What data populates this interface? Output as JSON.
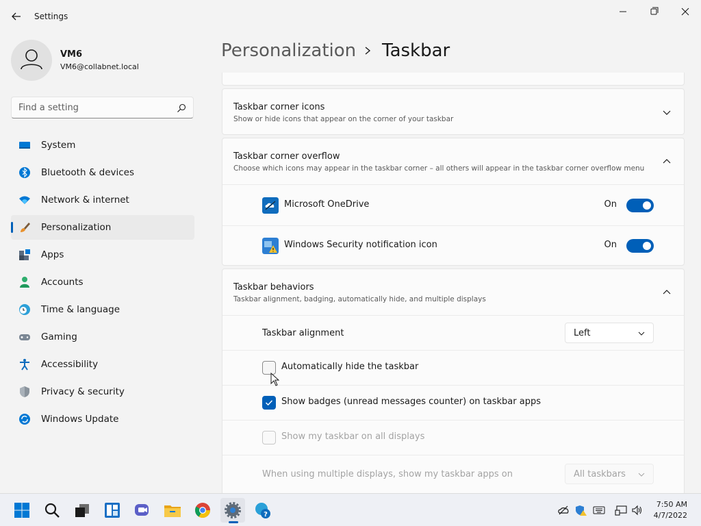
{
  "window": {
    "app_title": "Settings"
  },
  "profile": {
    "name": "VM6",
    "email": "VM6@collabnet.local"
  },
  "search": {
    "placeholder": "Find a setting"
  },
  "sidebar": {
    "items": [
      {
        "label": "System",
        "icon": "system-icon"
      },
      {
        "label": "Bluetooth & devices",
        "icon": "bluetooth-icon"
      },
      {
        "label": "Network & internet",
        "icon": "wifi-icon"
      },
      {
        "label": "Personalization",
        "icon": "brush-icon",
        "active": true
      },
      {
        "label": "Apps",
        "icon": "apps-icon"
      },
      {
        "label": "Accounts",
        "icon": "accounts-icon"
      },
      {
        "label": "Time & language",
        "icon": "clock-globe-icon"
      },
      {
        "label": "Gaming",
        "icon": "gamepad-icon"
      },
      {
        "label": "Accessibility",
        "icon": "accessibility-icon"
      },
      {
        "label": "Privacy & security",
        "icon": "shield-icon"
      },
      {
        "label": "Windows Update",
        "icon": "update-icon"
      }
    ]
  },
  "breadcrumb": {
    "parent": "Personalization",
    "current": "Taskbar"
  },
  "sections": {
    "corner_icons": {
      "title": "Taskbar corner icons",
      "description": "Show or hide icons that appear on the corner of your taskbar"
    },
    "corner_overflow": {
      "title": "Taskbar corner overflow",
      "description": "Choose which icons may appear in the taskbar corner – all others will appear in the taskbar corner overflow menu",
      "items": [
        {
          "label": "Microsoft OneDrive",
          "state": "On",
          "on": true,
          "icon": "onedrive-icon"
        },
        {
          "label": "Windows Security notification icon",
          "state": "On",
          "on": true,
          "icon": "security-warning-icon"
        }
      ]
    },
    "behaviors": {
      "title": "Taskbar behaviors",
      "description": "Taskbar alignment, badging, automatically hide, and multiple displays",
      "alignment_label": "Taskbar alignment",
      "alignment_value": "Left",
      "auto_hide_label": "Automatically hide the taskbar",
      "auto_hide_checked": false,
      "badges_label": "Show badges (unread messages counter) on taskbar apps",
      "badges_checked": true,
      "all_displays_label": "Show my taskbar on all displays",
      "all_displays_checked": false,
      "multi_display_label": "When using multiple displays, show my taskbar apps on",
      "multi_display_value": "All taskbars"
    }
  },
  "taskbar": {
    "apps": [
      "start-icon",
      "search-icon",
      "task-view-icon",
      "widgets-icon",
      "teams-chat-icon",
      "file-explorer-icon",
      "chrome-icon",
      "settings-icon",
      "get-help-icon"
    ],
    "time": "7:50 AM",
    "date": "4/7/2022"
  },
  "colors": {
    "accent": "#005fb8",
    "background": "#f3f3f3",
    "card": "#fbfbfb"
  }
}
